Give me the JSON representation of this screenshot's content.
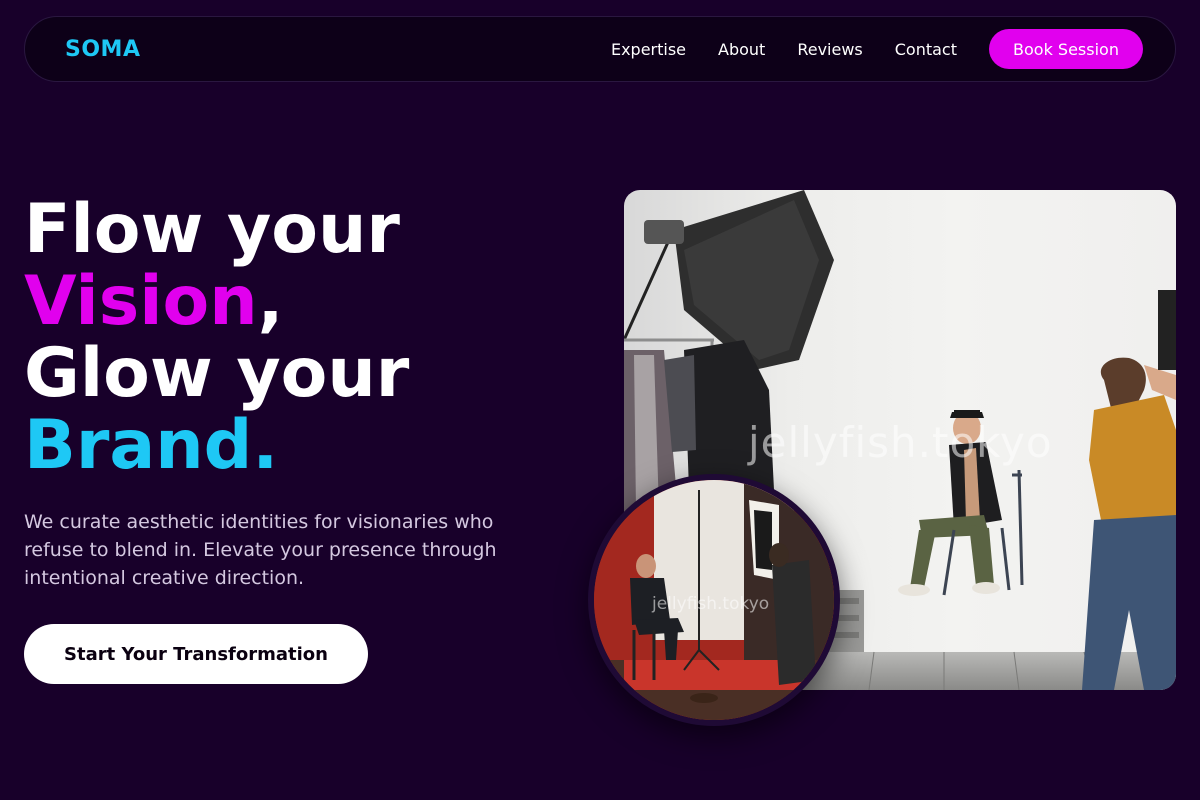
{
  "brand": {
    "logo": "SOMA"
  },
  "nav": {
    "links": [
      "Expertise",
      "About",
      "Reviews",
      "Contact"
    ],
    "cta": "Book Session"
  },
  "hero": {
    "title_line1": "Flow your",
    "title_accent1": "Vision",
    "title_comma": ",",
    "title_line3": "Glow your",
    "title_accent2": "Brand.",
    "subtitle": "We curate aesthetic identities for visionaries who refuse to blend in. Elevate your presence through intentional creative direction.",
    "cta": "Start Your Transformation"
  },
  "images": {
    "main_watermark": "jellyfish.tokyo",
    "inset_watermark": "jellyfish.tokyo"
  },
  "colors": {
    "background": "#18002a",
    "accent_magenta": "#e100ee",
    "accent_cyan": "#1ec8f5"
  }
}
